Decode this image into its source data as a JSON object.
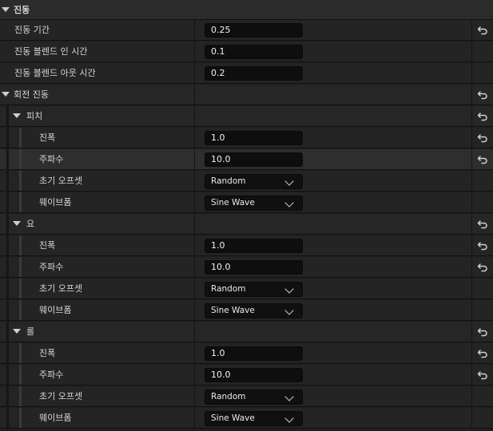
{
  "header": {
    "title": "진동"
  },
  "rows": [
    {
      "label": "진동 기간",
      "value": "0.25",
      "reset": true
    },
    {
      "label": "진동 블렌드 인 시간",
      "value": "0.1",
      "reset": false
    },
    {
      "label": "진동 블렌드 아웃 시간",
      "value": "0.2",
      "reset": false
    }
  ],
  "rotation": {
    "label": "회전 진동",
    "reset": true
  },
  "groups": [
    {
      "label": "피치",
      "amplitude_label": "진폭",
      "amplitude": "1.0",
      "frequency_label": "주파수",
      "frequency": "10.0",
      "offset_label": "초기 오프셋",
      "offset": "Random",
      "waveform_label": "웨이브폼",
      "waveform": "Sine Wave"
    },
    {
      "label": "요",
      "amplitude_label": "진폭",
      "amplitude": "1.0",
      "frequency_label": "주파수",
      "frequency": "10.0",
      "offset_label": "초기 오프셋",
      "offset": "Random",
      "waveform_label": "웨이브폼",
      "waveform": "Sine Wave"
    },
    {
      "label": "롤",
      "amplitude_label": "진폭",
      "amplitude": "1.0",
      "frequency_label": "주파수",
      "frequency": "10.0",
      "offset_label": "초기 오프셋",
      "offset": "Random",
      "waveform_label": "웨이브폼",
      "waveform": "Sine Wave"
    }
  ],
  "icons": {
    "expand": "chevron-down-icon",
    "reset": "reset-to-default-icon",
    "dropdown": "chevron-down-icon"
  }
}
